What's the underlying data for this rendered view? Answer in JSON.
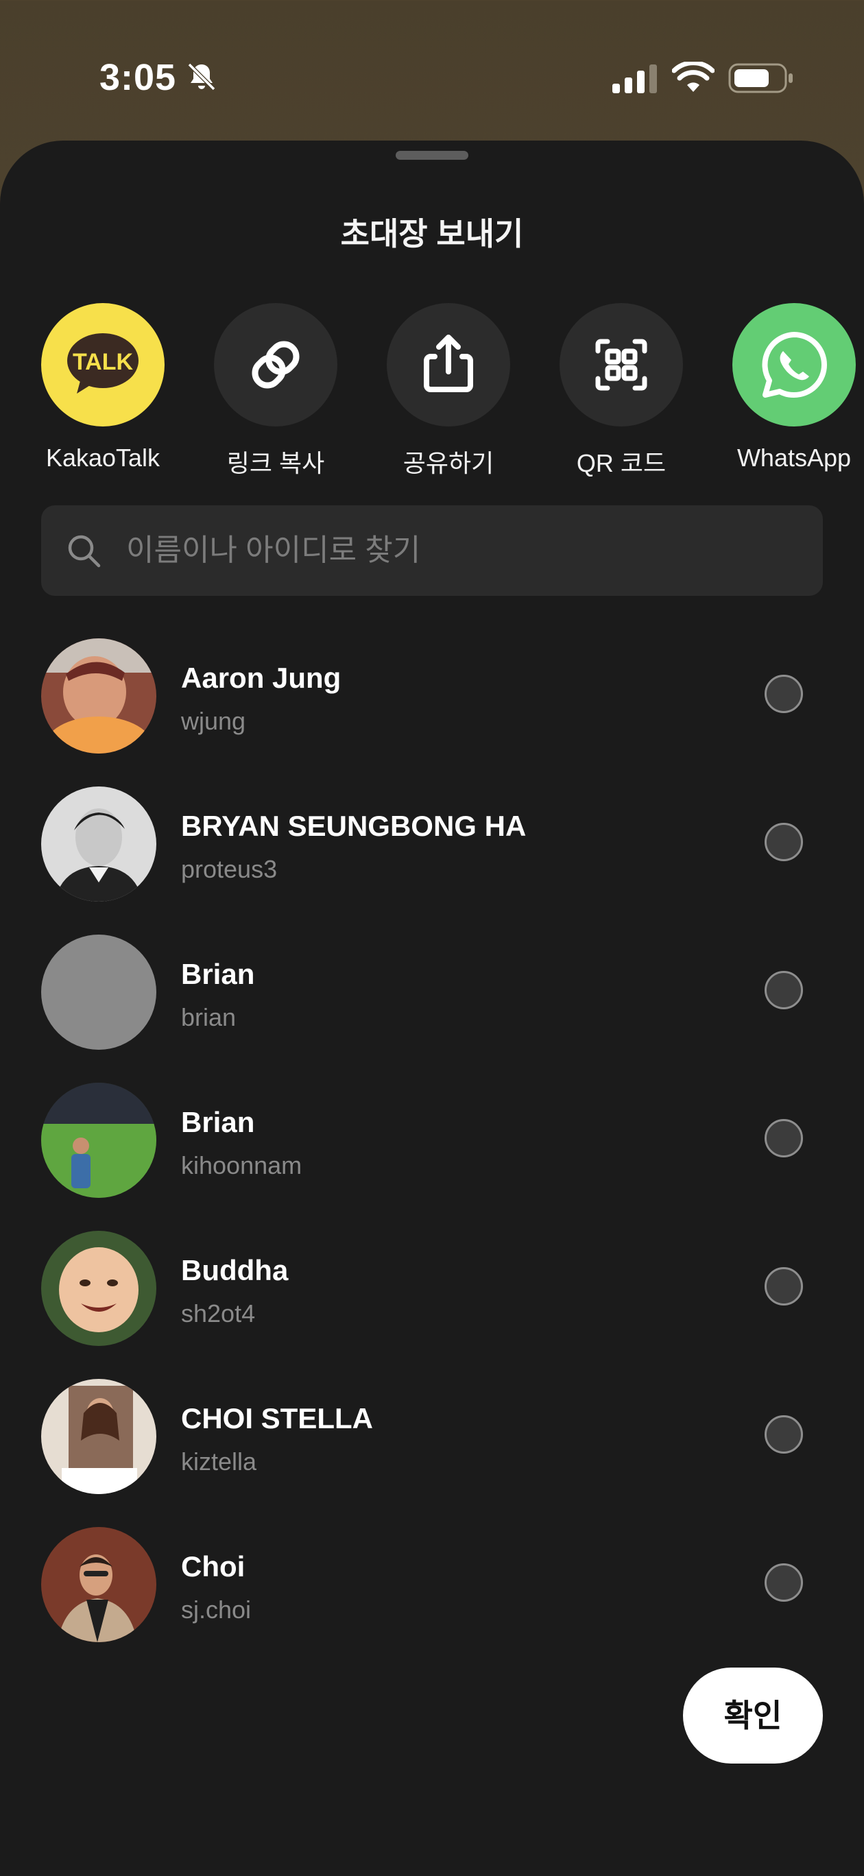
{
  "status_bar": {
    "time": "3:05",
    "icons": [
      "bell-slash-icon",
      "cellular-signal-icon",
      "wifi-icon",
      "battery-icon"
    ]
  },
  "sheet": {
    "title": "초대장 보내기"
  },
  "share_options": [
    {
      "label": "KakaoTalk",
      "icon": "kakaotalk-icon",
      "color": "#f7e04b"
    },
    {
      "label": "링크 복사",
      "icon": "link-icon",
      "color": "#2c2c2c"
    },
    {
      "label": "공유하기",
      "icon": "share-icon",
      "color": "#2c2c2c"
    },
    {
      "label": "QR 코드",
      "icon": "qr-code-icon",
      "color": "#2c2c2c"
    },
    {
      "label": "WhatsApp",
      "icon": "whatsapp-icon",
      "color": "#63cd74"
    }
  ],
  "search": {
    "placeholder": "이름이나 아이디로 찾기",
    "value": ""
  },
  "contacts": [
    {
      "name": "Aaron Jung",
      "username": "wjung",
      "selected": false
    },
    {
      "name": "BRYAN SEUNGBONG HA",
      "username": "proteus3",
      "selected": false
    },
    {
      "name": "Brian",
      "username": "brian",
      "selected": false
    },
    {
      "name": "Brian",
      "username": "kihoonnam",
      "selected": false
    },
    {
      "name": "Buddha",
      "username": "sh2ot4",
      "selected": false
    },
    {
      "name": "CHOI STELLA",
      "username": "kiztella",
      "selected": false
    },
    {
      "name": "Choi",
      "username": "sj.choi",
      "selected": false
    }
  ],
  "confirm_button": {
    "label": "확인"
  },
  "colors": {
    "sheet_background": "#1b1b1b",
    "kakao_yellow": "#f7e04b",
    "whatsapp_green": "#63cd74"
  }
}
